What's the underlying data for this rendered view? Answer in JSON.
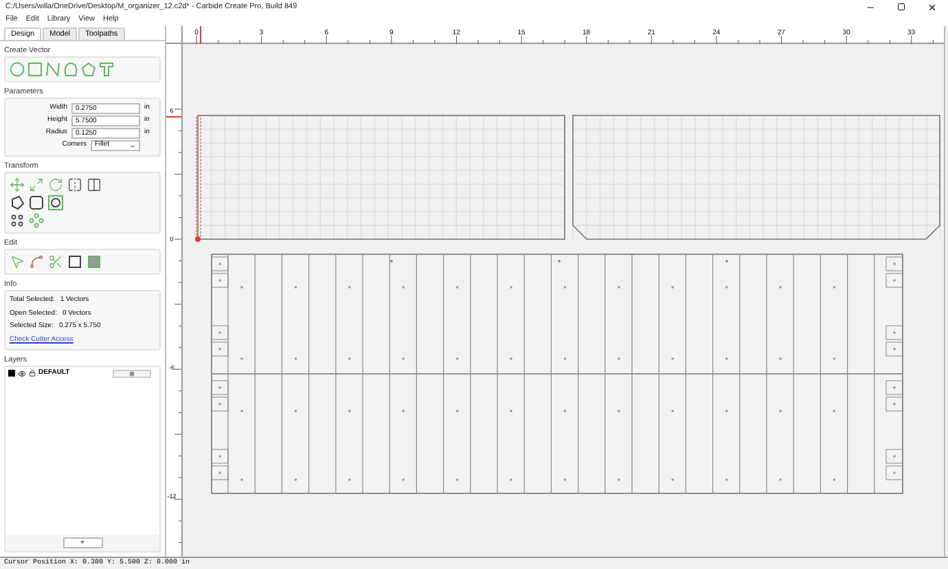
{
  "window": {
    "title": "C:/Users/willa/OneDrive/Desktop/M_organizer_12.c2d* - Carbide Create Pro, Build 849"
  },
  "menu": [
    "File",
    "Edit",
    "Library",
    "View",
    "Help"
  ],
  "tabs": [
    {
      "label": "Design",
      "selected": true
    },
    {
      "label": "Model",
      "selected": false
    },
    {
      "label": "Toolpaths",
      "selected": false
    }
  ],
  "create_vector": {
    "title": "Create Vector"
  },
  "parameters": {
    "title": "Parameters",
    "fields": [
      {
        "label": "Width",
        "value": "0.2750",
        "unit": "in"
      },
      {
        "label": "Height",
        "value": "5.7500",
        "unit": "in"
      },
      {
        "label": "Radius",
        "value": "0.1250",
        "unit": "in"
      }
    ],
    "corners": {
      "label": "Corners",
      "value": "Fillet"
    }
  },
  "transform": {
    "title": "Transform"
  },
  "edit": {
    "title": "Edit"
  },
  "info": {
    "title": "Info",
    "rows": [
      {
        "label": "Total Selected:",
        "value": "1 Vectors"
      },
      {
        "label": "Open Selected:",
        "value": "0 Vectors"
      },
      {
        "label": "Selected Size:",
        "value": "0.275 x 5.750"
      }
    ],
    "link": "Check Cutter Access"
  },
  "layers": {
    "title": "Layers",
    "items": [
      {
        "name": "DEFAULT",
        "color": "#000000"
      }
    ],
    "add_button": "+"
  },
  "ruler": {
    "x_labels": [
      "0",
      "3",
      "6",
      "9",
      "12",
      "15",
      "18",
      "21",
      "24",
      "27",
      "30",
      "33"
    ],
    "y_labels": [
      "6",
      "0",
      "-6",
      "-12"
    ]
  },
  "status_bar": "Cursor Position X: 0.300 Y: 5.500 Z: 0.000 in"
}
